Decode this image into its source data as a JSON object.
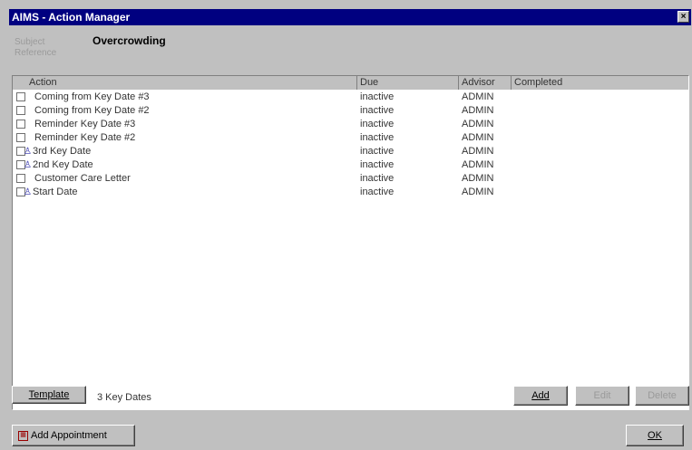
{
  "window": {
    "title": "AIMS - Action Manager",
    "close": "×"
  },
  "header": {
    "subject_label": "Subject",
    "reference_label": "Reference",
    "subject_value": "Overcrowding"
  },
  "columns": [
    "Action",
    "Due",
    "Advisor",
    "Completed"
  ],
  "rows": [
    {
      "action": "Coming from Key Date #3",
      "due": "inactive",
      "advisor": "ADMIN",
      "completed": "",
      "pinned": false
    },
    {
      "action": "Coming from Key Date #2",
      "due": "inactive",
      "advisor": "ADMIN",
      "completed": "",
      "pinned": false
    },
    {
      "action": "Reminder Key Date #3",
      "due": "inactive",
      "advisor": "ADMIN",
      "completed": "",
      "pinned": false
    },
    {
      "action": "Reminder Key Date #2",
      "due": "inactive",
      "advisor": "ADMIN",
      "completed": "",
      "pinned": false
    },
    {
      "action": "3rd Key Date",
      "due": "inactive",
      "advisor": "ADMIN",
      "completed": "",
      "pinned": true
    },
    {
      "action": "2nd Key Date",
      "due": "inactive",
      "advisor": "ADMIN",
      "completed": "",
      "pinned": true
    },
    {
      "action": "Customer Care Letter",
      "due": "inactive",
      "advisor": "ADMIN",
      "completed": "",
      "pinned": false
    },
    {
      "action": "Start Date",
      "due": "inactive",
      "advisor": "ADMIN",
      "completed": "",
      "pinned": true
    }
  ],
  "toolbar": {
    "template_label": "Template",
    "template_value": "3 Key Dates",
    "add_label": "Add",
    "edit_label": "Edit",
    "delete_label": "Delete",
    "add_appointment_label": "Add Appointment",
    "ok_label": "OK"
  }
}
